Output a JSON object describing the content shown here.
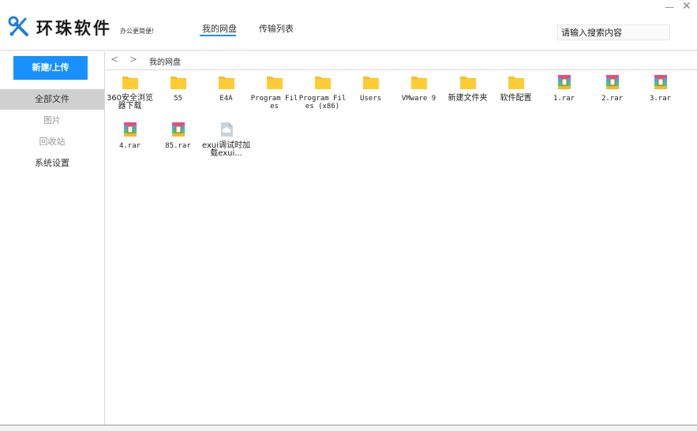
{
  "header": {
    "brand": "环珠软件",
    "slogan": "办公更简便!",
    "tabs": [
      {
        "label": "我的网盘"
      },
      {
        "label": "传输列表"
      }
    ],
    "search_placeholder": "请输入搜索内容",
    "minimize_label": "—",
    "close_label": "✕",
    "accent_color": "#1890ff"
  },
  "sidebar": {
    "new_upload_label": "新建/上传",
    "items": [
      {
        "label": "全部文件"
      },
      {
        "label": "图片"
      },
      {
        "label": "回收站"
      },
      {
        "label": "系统设置"
      }
    ]
  },
  "pathbar": {
    "back_label": "<",
    "forward_label": ">",
    "path": "我的网盘"
  },
  "files": [
    {
      "name": "360安全浏览器下载",
      "type": "folder"
    },
    {
      "name": "55",
      "type": "folder"
    },
    {
      "name": "E4A",
      "type": "folder"
    },
    {
      "name": "Program Files",
      "type": "folder"
    },
    {
      "name": "Program Files (x86)",
      "type": "folder"
    },
    {
      "name": "Users",
      "type": "folder"
    },
    {
      "name": "VMware 9",
      "type": "folder"
    },
    {
      "name": "新建文件夹",
      "type": "folder"
    },
    {
      "name": "软件配置",
      "type": "folder"
    },
    {
      "name": "1.rar",
      "type": "rar"
    },
    {
      "name": "2.rar",
      "type": "rar"
    },
    {
      "name": "3.rar",
      "type": "rar"
    },
    {
      "name": "4.rar",
      "type": "rar"
    },
    {
      "name": "85.rar",
      "type": "rar"
    },
    {
      "name": "exui调试时加载exui...",
      "type": "cloud"
    }
  ]
}
